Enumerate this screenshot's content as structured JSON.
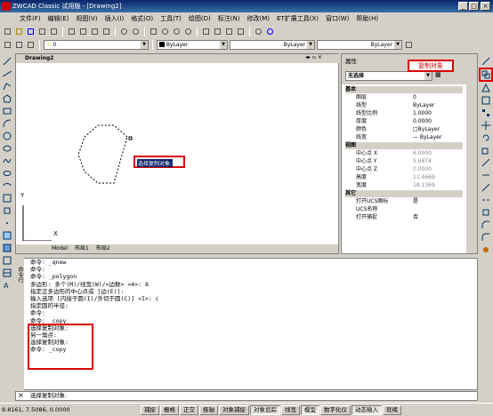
{
  "window": {
    "title": "ZWCAD Classic 试用版 - [Drawing2]",
    "min": "_",
    "max": "□",
    "close": "×"
  },
  "menu": [
    "文件(F)",
    "编辑(E)",
    "视图(V)",
    "插入(I)",
    "格式(O)",
    "工具(T)",
    "绘图(D)",
    "标注(N)",
    "修改(M)",
    "ET扩展工具(X)",
    "窗口(W)",
    "帮助(H)"
  ],
  "toolbar2": {
    "layer": "0",
    "color": "ByLayer",
    "linetype": "ByLayer",
    "lineweight": "ByLayer"
  },
  "drawing": {
    "tab": "Drawing2",
    "tooltip": "选择复制对象:",
    "y_axis": "Y",
    "x_axis": "X",
    "layout_tabs": [
      "Model",
      "布局1",
      "布局2"
    ]
  },
  "properties": {
    "title": "属性",
    "selection": "无选择",
    "callout": "复制对象",
    "groups": [
      {
        "name": "基本",
        "rows": [
          [
            "图层",
            "0"
          ],
          [
            "线型",
            "ByLayer"
          ],
          [
            "线型比例",
            "1.0000"
          ],
          [
            "厚度",
            "0.0000"
          ],
          [
            "颜色",
            "□ByLayer"
          ],
          [
            "线宽",
            "— ByLayer"
          ]
        ]
      },
      {
        "name": "视图",
        "rows": [
          [
            "中心点 X",
            "6.0000"
          ],
          [
            "中心点 Y",
            "5.6874"
          ],
          [
            "中心点 Z",
            "0.0000"
          ],
          [
            "高度",
            "11.4669"
          ],
          [
            "宽度",
            "18.1369"
          ]
        ]
      },
      {
        "name": "其它",
        "rows": [
          [
            "打开UCS图标",
            "是"
          ],
          [
            "UCS名称",
            ""
          ],
          [
            "打开捕捉",
            "否"
          ]
        ]
      }
    ]
  },
  "command_history": [
    "命令: _qnew",
    "命令:",
    "命令: _polygon",
    "多边形:  多个(M)/线宽(W)/<边数> <4>: 8",
    "指定正多边形的中心点或 [边(E)]:",
    "输入选项 [内接于圆(I)/外切于圆(C)] <I>: c",
    "指定圆的半径:",
    "命令:",
    "命令: _copy",
    "选择复制对象:",
    "另一角点:",
    "选择复制对象:",
    "命令: _copy"
  ],
  "command_side": "命令行",
  "command_input": "选择复制对象:",
  "status": {
    "coords": "8.8161,  7.5086,  0.0000",
    "buttons": [
      "捕捉",
      "栅格",
      "正交",
      "极轴",
      "对象捕捉",
      "对象追踪",
      "线宽",
      "模型",
      "数字化仪",
      "动态输入",
      "就绪"
    ],
    "on": [
      "对象追踪",
      "模型",
      "动态输入"
    ]
  }
}
